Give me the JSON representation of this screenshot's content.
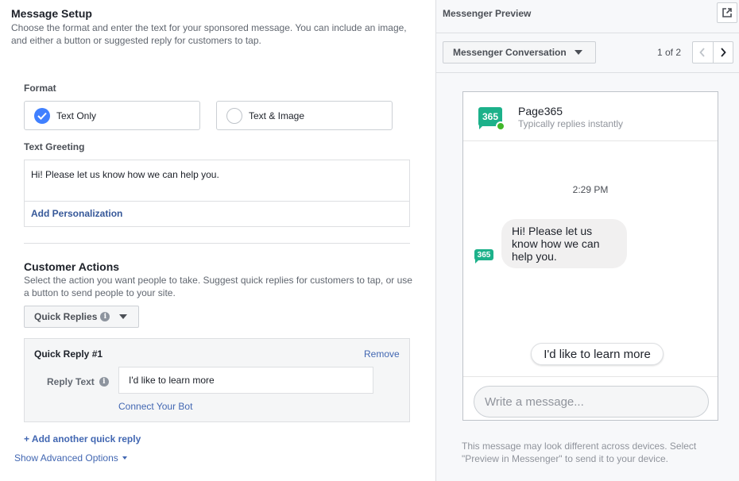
{
  "setup": {
    "title": "Message Setup",
    "description": "Choose the format and enter the text for your sponsored message. You can include an image, and either a button or suggested reply for customers to tap."
  },
  "format": {
    "label": "Format",
    "options": [
      {
        "label": "Text Only",
        "selected": true
      },
      {
        "label": "Text & Image",
        "selected": false
      }
    ]
  },
  "greeting": {
    "label": "Text Greeting",
    "value": "Hi! Please let us know how we can help you.",
    "add_personalization": "Add Personalization"
  },
  "customer_actions": {
    "title": "Customer Actions",
    "description": "Select the action you want people to take. Suggest quick replies for customers to tap, or use a button to send people to your site.",
    "dropdown_label": "Quick Replies",
    "info_glyph": "i",
    "quick_reply": {
      "title": "Quick Reply #1",
      "remove": "Remove",
      "reply_text_label": "Reply Text",
      "reply_text_value": "I'd like to learn more",
      "connect_bot": "Connect Your Bot"
    },
    "add_another": "+ Add another quick reply",
    "show_advanced": "Show Advanced Options"
  },
  "preview": {
    "title": "Messenger Preview",
    "dropdown_label": "Messenger Conversation",
    "pager_text": "1 of 2",
    "page_name": "Page365",
    "page_status": "Typically replies instantly",
    "logo_text": "365",
    "timestamp": "2:29 PM",
    "bubble_text": "Hi! Please let us know how we can help you.",
    "quick_reply_chip": "I'd like to learn more",
    "composer_placeholder": "Write a message...",
    "disclaimer": "This message may look different across devices. Select \"Preview in Messenger\" to send it to your device."
  },
  "colors": {
    "accent": "#4080ff",
    "link": "#4267b2",
    "logo": "#1cb18a",
    "online": "#42b72a"
  },
  "icons": [
    "check-icon",
    "info-icon",
    "caret-down-icon",
    "external-link-icon",
    "chevron-left-icon",
    "chevron-right-icon"
  ]
}
